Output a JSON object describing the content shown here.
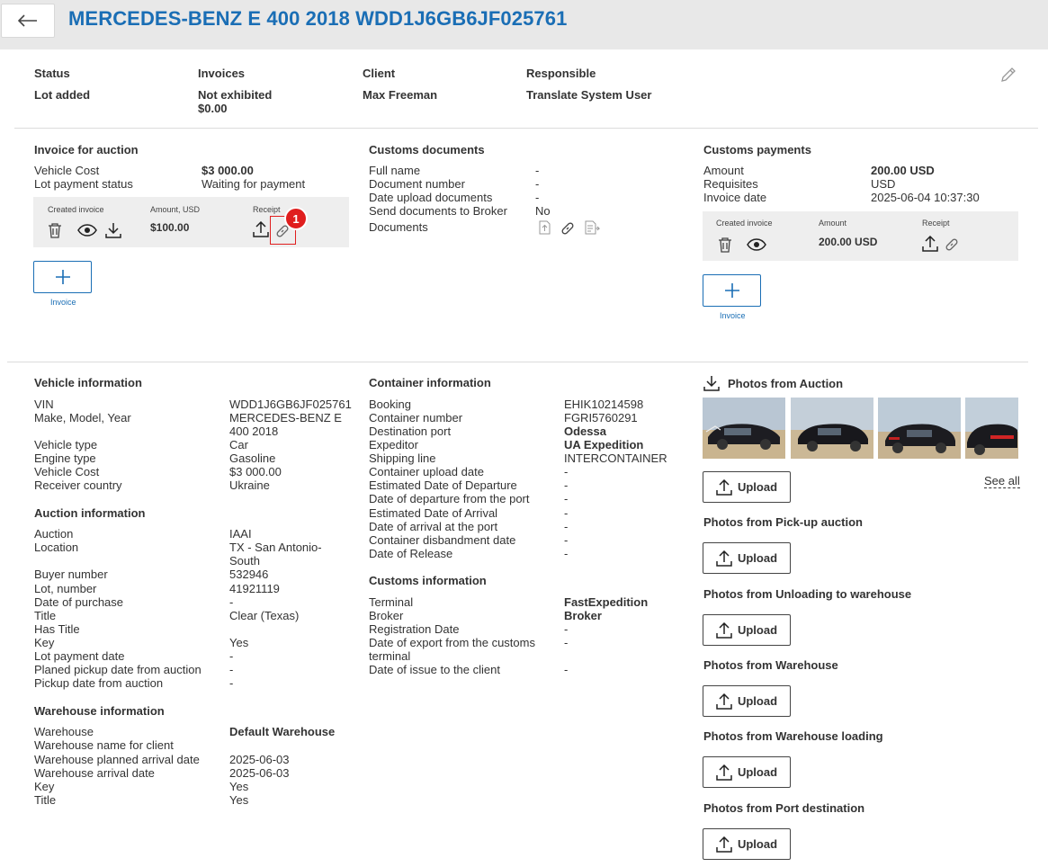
{
  "header": {
    "title": "MERCEDES-BENZ E 400 2018 WDD1J6GB6JF025761"
  },
  "summary": {
    "status_label": "Status",
    "status_value": "Lot added",
    "invoices_label": "Invoices",
    "invoices_value": "Not exhibited",
    "invoices_amount": "$0.00",
    "client_label": "Client",
    "client_value": "Max Freeman",
    "responsible_label": "Responsible",
    "responsible_value": "Translate System User"
  },
  "invoice_auction": {
    "title": "Invoice for auction",
    "vehicle_cost_label": "Vehicle Cost",
    "vehicle_cost_value": "$3 000.00",
    "lot_payment_label": "Lot payment status",
    "lot_payment_value": "Waiting for payment",
    "col_created": "Created invoice",
    "col_amount": "Amount, USD",
    "col_receipt": "Receipt",
    "amount": "$100.00",
    "badge": "1",
    "add_label": "Invoice"
  },
  "customs_docs": {
    "title": "Customs documents",
    "rows": [
      {
        "label": "Full name",
        "value": "-"
      },
      {
        "label": "Document number",
        "value": "-"
      },
      {
        "label": "Date upload documents",
        "value": "-"
      },
      {
        "label": "Send documents to Broker",
        "value": "No"
      }
    ],
    "documents_label": "Documents"
  },
  "customs_payments": {
    "title": "Customs payments",
    "amount_label": "Amount",
    "amount_value": "200.00 USD",
    "requisites_label": "Requisites",
    "requisites_value": "USD",
    "invoice_date_label": "Invoice date",
    "invoice_date_value": "2025-06-04 10:37:30",
    "col_created": "Created invoice",
    "col_amount": "Amount",
    "col_receipt": "Receipt",
    "amount": "200.00 USD",
    "add_label": "Invoice"
  },
  "vehicle_info": {
    "title": "Vehicle information",
    "vin_label": "VIN",
    "vin_value": "WDD1J6GB6JF025761",
    "mmy_label": "Make, Model, Year",
    "mmy_value_1": "MERCEDES-BENZ E",
    "mmy_value_2": "400 2018",
    "type_label": "Vehicle type",
    "type_value": "Car",
    "engine_label": "Engine type",
    "engine_value": "Gasoline",
    "cost_label": "Vehicle Cost",
    "cost_value": "$3 000.00",
    "country_label": "Receiver country",
    "country_value": "Ukraine"
  },
  "auction_info": {
    "title": "Auction information",
    "auction_label": "Auction",
    "auction_value": "IAAI",
    "location_label": "Location",
    "location_value_1": "TX - San Antonio-",
    "location_value_2": "South",
    "buyer_label": "Buyer number",
    "buyer_value": "532946",
    "lot_label": "Lot, number",
    "lot_value": "41921119",
    "purchase_label": "Date of purchase",
    "purchase_value": "-",
    "title_label": "Title",
    "title_value": "Clear (Texas)",
    "has_title_label": "Has Title",
    "key_label": "Key",
    "key_value": "Yes",
    "lot_pay_label": "Lot payment date",
    "lot_pay_value": "-",
    "planned_label": "Planed pickup date from auction",
    "planned_value": "-",
    "pickup_label": "Pickup date from auction",
    "pickup_value": "-"
  },
  "warehouse_info": {
    "title": "Warehouse information",
    "warehouse_label": "Warehouse",
    "warehouse_value": "Default Warehouse",
    "name_client_label": "Warehouse name for client",
    "planned_label": "Warehouse planned arrival date",
    "planned_value": "2025-06-03",
    "arrival_label": "Warehouse arrival date",
    "arrival_value": "2025-06-03",
    "key_label": "Key",
    "key_value": "Yes",
    "title_label": "Title",
    "title_value": "Yes"
  },
  "container_info": {
    "title": "Container information",
    "booking_label": "Booking",
    "booking_value": "EHIK10214598",
    "number_label": "Container number",
    "number_value": "FGRI5760291",
    "dest_label": "Destination port",
    "dest_value": "Odessa",
    "expeditor_label": "Expeditor",
    "expeditor_value": "UA Expedition",
    "shipping_label": "Shipping line",
    "shipping_value": "INTERCONTAINER",
    "rows": [
      {
        "label": "Container upload date",
        "value": "-"
      },
      {
        "label": "Estimated Date of Departure",
        "value": "-"
      },
      {
        "label": "Date of departure from the port",
        "value": "-"
      },
      {
        "label": "Estimated Date of Arrival",
        "value": "-"
      },
      {
        "label": "Date of arrival at the port",
        "value": "-"
      },
      {
        "label": "Container disbandment date",
        "value": "-"
      },
      {
        "label": "Date of Release",
        "value": "-"
      }
    ]
  },
  "customs_info": {
    "title": "Customs information",
    "terminal_label": "Terminal",
    "terminal_value": "FastExpedition",
    "broker_label": "Broker",
    "broker_value": "Broker",
    "reg_label": "Registration Date",
    "reg_value": "-",
    "export_label_1": "Date of export from the customs",
    "export_label_2": "terminal",
    "export_value": "-",
    "issue_label": "Date of issue to the client",
    "issue_value": "-"
  },
  "photos": {
    "auction_title": "Photos from Auction",
    "see_all": "See all",
    "upload": "Upload",
    "pickup_title": "Photos from Pick-up auction",
    "unloading_title": "Photos from Unloading to warehouse",
    "warehouse_title": "Photos from Warehouse",
    "warehouse_loading_title": "Photos from Warehouse loading",
    "port_title": "Photos from Port destination"
  },
  "colors": {
    "accent": "#1a6eb5",
    "orange": "#ee7d00",
    "green": "#22b07d",
    "red": "#d40000"
  }
}
